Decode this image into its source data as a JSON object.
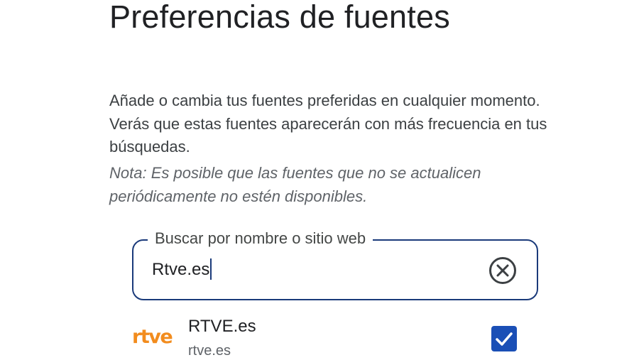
{
  "page": {
    "title": "Preferencias de fuentes",
    "description": "Añade o cambia tus fuentes preferidas en cualquier momento. Verás que estas fuentes aparecerán con más frecuencia en tus búsquedas.",
    "note": "Nota: Es posible que las fuentes que no se actualicen periódicamente no estén disponibles."
  },
  "search": {
    "label": "Buscar por nombre o sitio web",
    "value": "Rtve.es",
    "clear_icon": "clear-circle-icon"
  },
  "results": [
    {
      "logo_text": "rtve",
      "name": "RTVE.es",
      "domain": "rtve.es",
      "selected": true
    }
  ],
  "colors": {
    "accent": "#1a4fb6",
    "field_border": "#1a3a7a",
    "logo_orange": "#f28c1e",
    "text_primary": "#202124",
    "text_secondary": "#5f6368"
  }
}
